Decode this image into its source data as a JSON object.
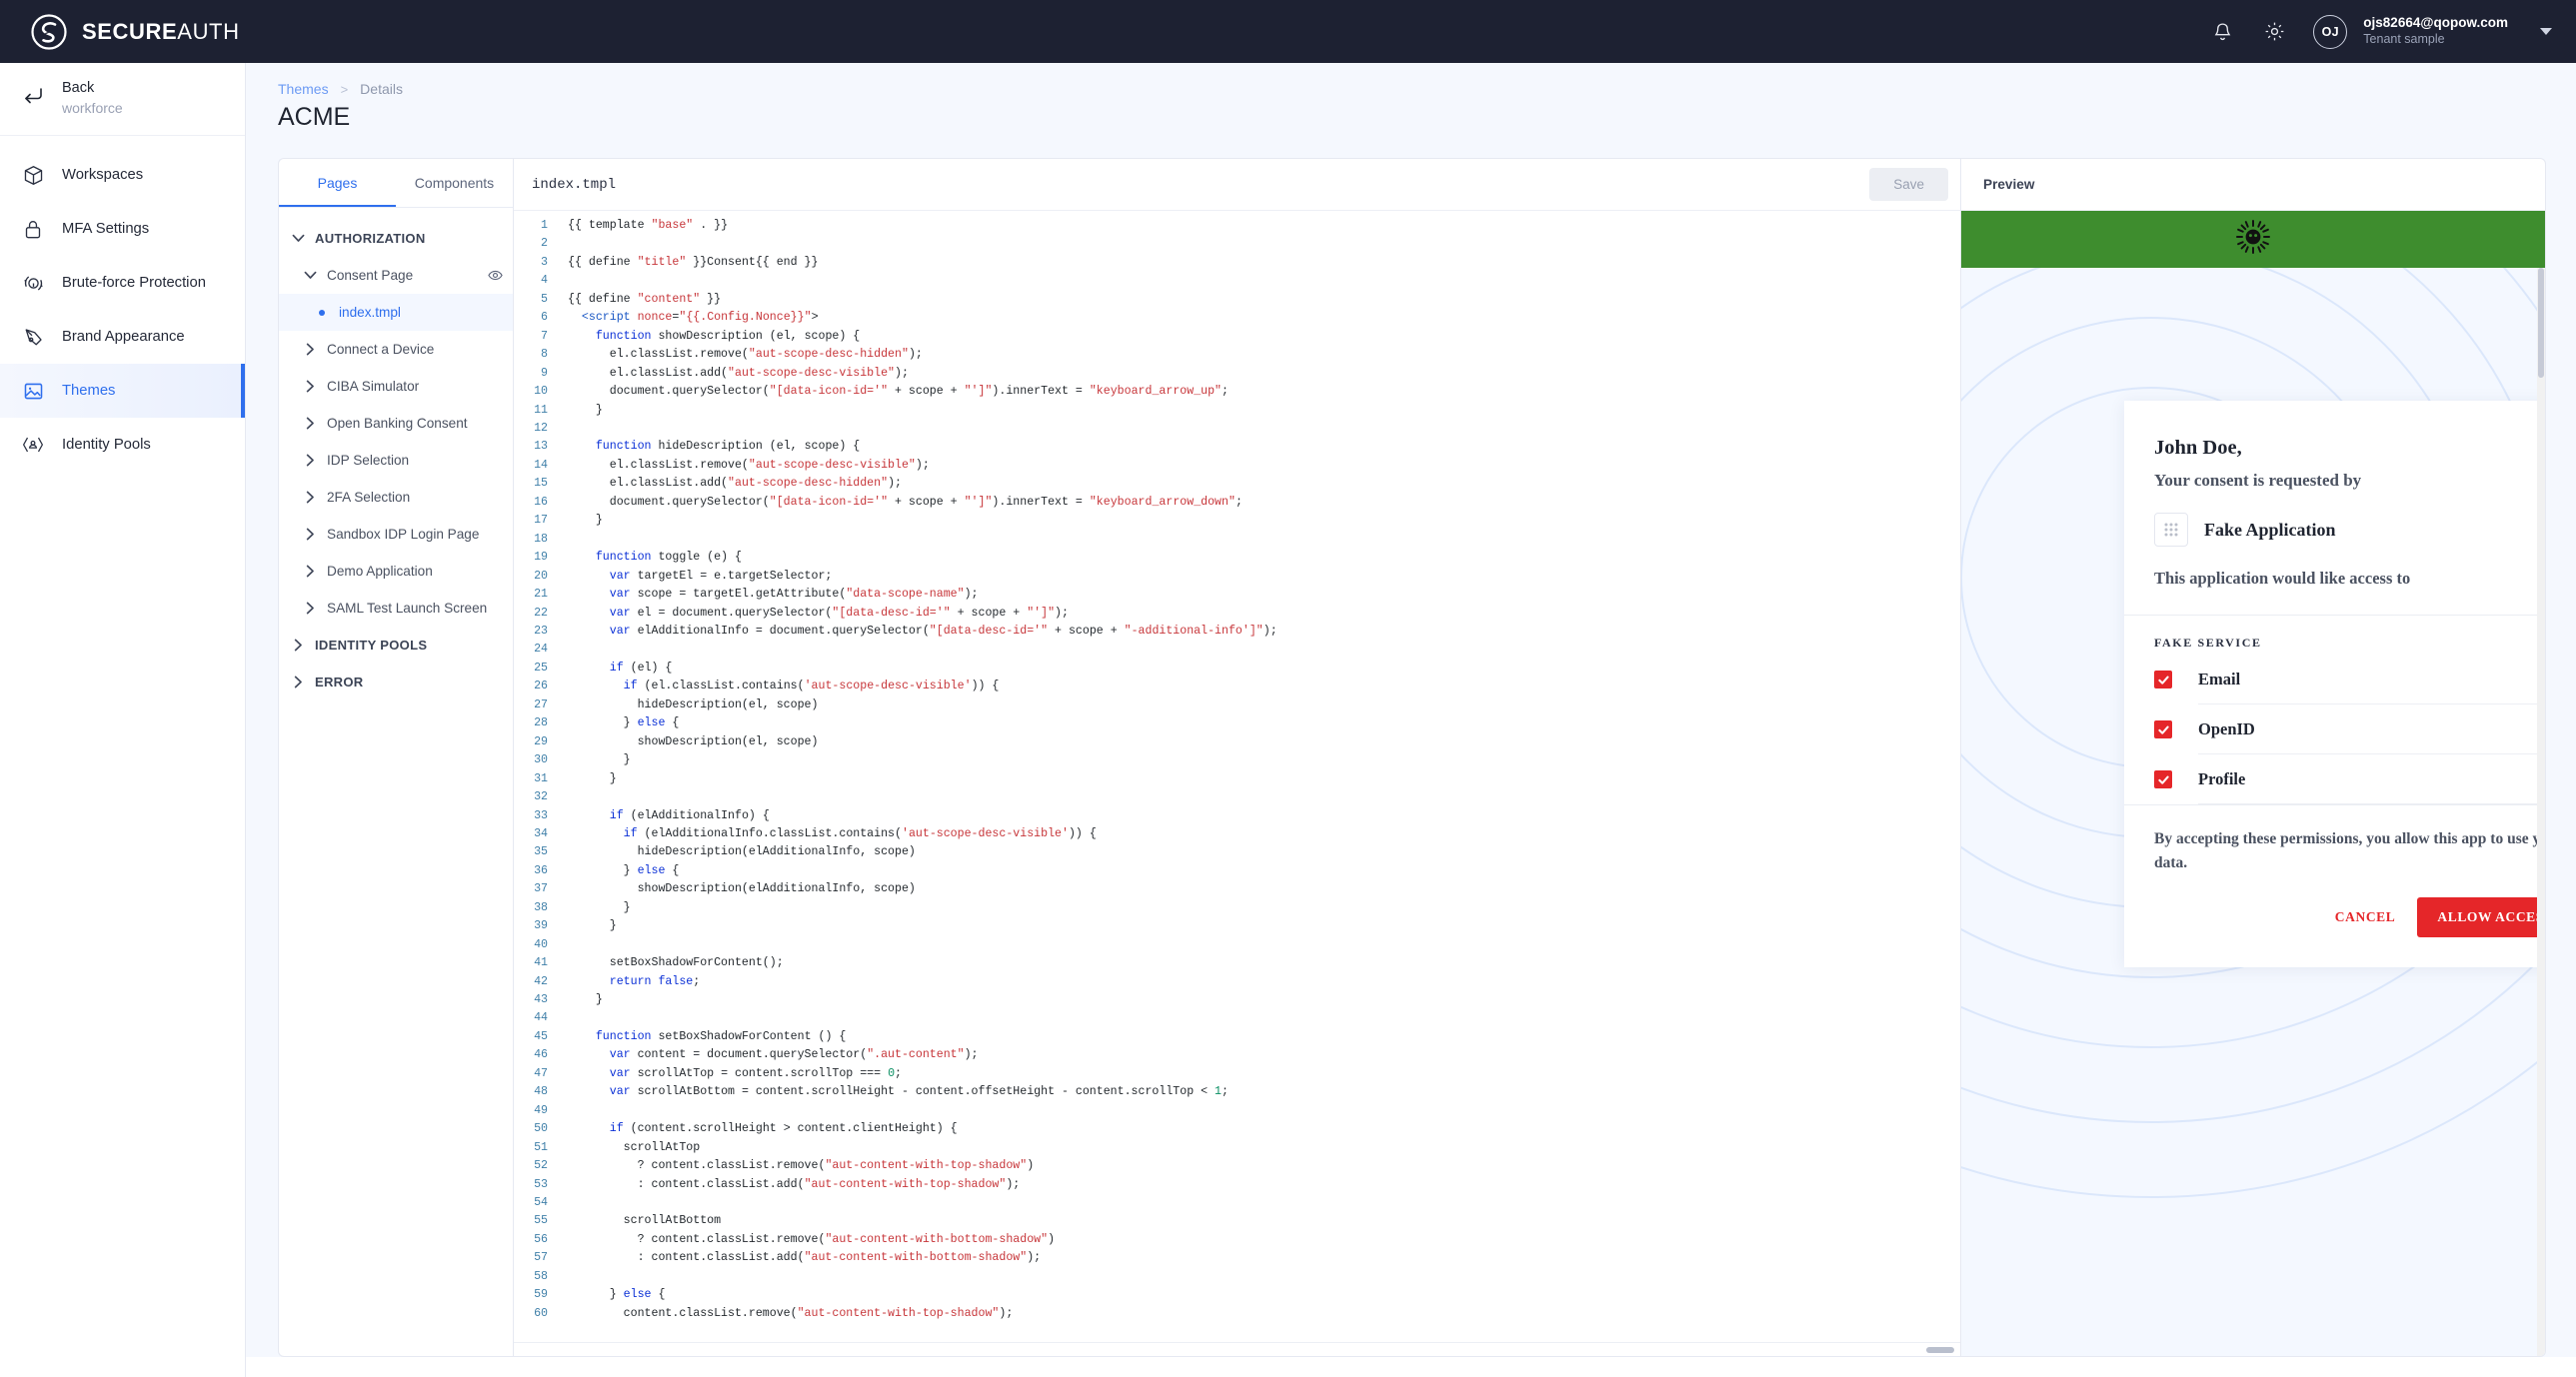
{
  "topbar": {
    "brand_bold": "SECURE",
    "brand_light": "AUTH",
    "bell_icon": "bell-icon",
    "gear_icon": "gear-icon",
    "avatar_initials": "OJ",
    "user_email": "ojs82664@qopow.com",
    "user_tenant": "Tenant sample"
  },
  "sidebar": {
    "back_label": "Back",
    "back_sub": "workforce",
    "items": [
      {
        "label": "Workspaces",
        "icon": "cube-icon",
        "active": false
      },
      {
        "label": "MFA Settings",
        "icon": "lock-icon",
        "active": false
      },
      {
        "label": "Brute-force Protection",
        "icon": "target-icon",
        "active": false
      },
      {
        "label": "Brand Appearance",
        "icon": "pen-icon",
        "active": false
      },
      {
        "label": "Themes",
        "icon": "image-icon",
        "active": true
      },
      {
        "label": "Identity Pools",
        "icon": "people-icon",
        "active": false
      }
    ]
  },
  "breadcrumb": {
    "root": "Themes",
    "separator": ">",
    "current": "Details"
  },
  "page_title": "ACME",
  "pages_panel": {
    "tabs": [
      {
        "label": "Pages",
        "active": true
      },
      {
        "label": "Components",
        "active": false
      }
    ],
    "tree": [
      {
        "level": 0,
        "label": "AUTHORIZATION",
        "chevron": "down",
        "selected": false
      },
      {
        "level": 1,
        "label": "Consent Page",
        "chevron": "down",
        "selected": false,
        "eye": true
      },
      {
        "level": 2,
        "label": "index.tmpl",
        "chevron": "dot",
        "selected": true
      },
      {
        "level": 1,
        "label": "Connect a Device",
        "chevron": "right",
        "selected": false
      },
      {
        "level": 1,
        "label": "CIBA Simulator",
        "chevron": "right",
        "selected": false
      },
      {
        "level": 1,
        "label": "Open Banking Consent",
        "chevron": "right",
        "selected": false
      },
      {
        "level": 1,
        "label": "IDP Selection",
        "chevron": "right",
        "selected": false
      },
      {
        "level": 1,
        "label": "2FA Selection",
        "chevron": "right",
        "selected": false
      },
      {
        "level": 1,
        "label": "Sandbox IDP Login Page",
        "chevron": "right",
        "selected": false
      },
      {
        "level": 1,
        "label": "Demo Application",
        "chevron": "right",
        "selected": false
      },
      {
        "level": 1,
        "label": "SAML Test Launch Screen",
        "chevron": "right",
        "selected": false
      },
      {
        "level": 0,
        "label": "IDENTITY POOLS",
        "chevron": "right",
        "selected": false
      },
      {
        "level": 0,
        "label": "ERROR",
        "chevron": "right",
        "selected": false
      }
    ]
  },
  "editor": {
    "filename": "index.tmpl",
    "save_label": "Save",
    "first_line": 1,
    "last_line": 60,
    "lines": [
      "{{ template \"base\" . }}",
      "",
      "{{ define \"title\" }}Consent{{ end }}",
      "",
      "{{ define \"content\" }}",
      "  <script nonce=\"{{.Config.Nonce}}\">",
      "    function showDescription (el, scope) {",
      "      el.classList.remove(\"aut-scope-desc-hidden\");",
      "      el.classList.add(\"aut-scope-desc-visible\");",
      "      document.querySelector(\"[data-icon-id='\" + scope + \"']\").innerText = \"keyboard_arrow_up\";",
      "    }",
      "",
      "    function hideDescription (el, scope) {",
      "      el.classList.remove(\"aut-scope-desc-visible\");",
      "      el.classList.add(\"aut-scope-desc-hidden\");",
      "      document.querySelector(\"[data-icon-id='\" + scope + \"']\").innerText = \"keyboard_arrow_down\";",
      "    }",
      "",
      "    function toggle (e) {",
      "      var targetEl = e.targetSelector;",
      "      var scope = targetEl.getAttribute(\"data-scope-name\");",
      "      var el = document.querySelector(\"[data-desc-id='\" + scope + \"']\");",
      "      var elAdditionalInfo = document.querySelector(\"[data-desc-id='\" + scope + \"-additional-info']\");",
      "",
      "      if (el) {",
      "        if (el.classList.contains('aut-scope-desc-visible')) {",
      "          hideDescription(el, scope)",
      "        } else {",
      "          showDescription(el, scope)",
      "        }",
      "      }",
      "",
      "      if (elAdditionalInfo) {",
      "        if (elAdditionalInfo.classList.contains('aut-scope-desc-visible')) {",
      "          hideDescription(elAdditionalInfo, scope)",
      "        } else {",
      "          showDescription(elAdditionalInfo, scope)",
      "        }",
      "      }",
      "",
      "      setBoxShadowForContent();",
      "      return false;",
      "    }",
      "",
      "    function setBoxShadowForContent () {",
      "      var content = document.querySelector(\".aut-content\");",
      "      var scrollAtTop = content.scrollTop === 0;",
      "      var scrollAtBottom = content.scrollHeight - content.offsetHeight - content.scrollTop < 1;",
      "",
      "      if (content.scrollHeight > content.clientHeight) {",
      "        scrollAtTop",
      "          ? content.classList.remove(\"aut-content-with-top-shadow\")",
      "          : content.classList.add(\"aut-content-with-top-shadow\");",
      "",
      "        scrollAtBottom",
      "          ? content.classList.remove(\"aut-content-with-bottom-shadow\")",
      "          : content.classList.add(\"aut-content-with-bottom-shadow\");",
      "",
      "      } else {",
      "        content.classList.remove(\"aut-content-with-top-shadow\");"
    ]
  },
  "preview": {
    "title": "Preview",
    "header_color": "#3e8d2e",
    "accent_color": "#e52629",
    "logo_icon": "sunburst-face-icon",
    "consent": {
      "user_name": "John Doe,",
      "subtitle": "Your consent is requested by",
      "app_icon": "grid-dots-icon",
      "app_name": "Fake Application",
      "access_text": "This application would like access to",
      "service_header": "FAKE SERVICE",
      "scopes": [
        {
          "label": "Email",
          "checked": true
        },
        {
          "label": "OpenID",
          "checked": true
        },
        {
          "label": "Profile",
          "checked": true
        }
      ],
      "note": "By accepting these permissions, you allow this app to use your data.",
      "cancel_label": "CANCEL",
      "allow_label": "ALLOW ACCESS"
    }
  }
}
